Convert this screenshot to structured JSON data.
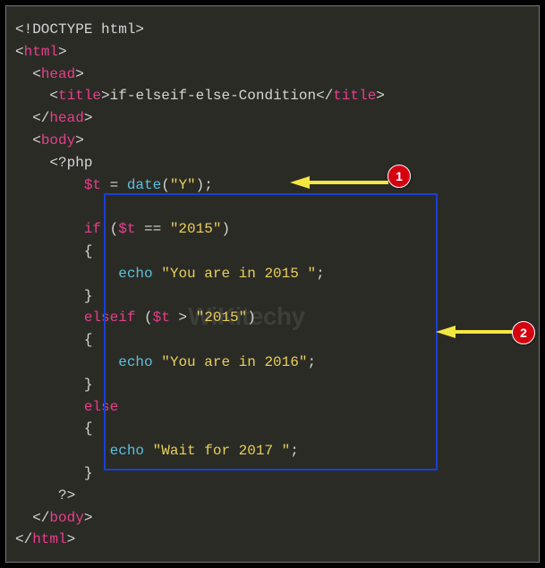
{
  "code": {
    "l1": "<!DOCTYPE html>",
    "l2_open": "<",
    "l2_tag": "html",
    "l2_close": ">",
    "l3_open": "  <",
    "l3_tag": "head",
    "l3_close": ">",
    "l4_open": "    <",
    "l4_tag": "title",
    "l4_close": ">",
    "l4_text": "if-elseif-else-Condition",
    "l4_endopen": "</",
    "l4_endtag": "title",
    "l4_endclose": ">",
    "l5_open": "  </",
    "l5_tag": "head",
    "l5_close": ">",
    "l6_open": "  <",
    "l6_tag": "body",
    "l6_close": ">",
    "l7": "    <?php",
    "l8_indent": "        ",
    "l8_var": "$t",
    "l8_op": " = ",
    "l8_func": "date",
    "l8_p1": "(",
    "l8_str": "\"Y\"",
    "l8_p2": ");",
    "l10_indent": "        ",
    "l10_kw": "if",
    "l10_p1": " (",
    "l10_var": "$t",
    "l10_op": " == ",
    "l10_str": "\"2015\"",
    "l10_p2": ")",
    "l11": "        {",
    "l12_indent": "            ",
    "l12_echo": "echo",
    "l12_sp": " ",
    "l12_str": "\"You are in 2015 \"",
    "l12_semi": ";",
    "l13": "        }",
    "l14_indent": "        ",
    "l14_kw": "elseif",
    "l14_p1": " (",
    "l14_var": "$t",
    "l14_op": " > ",
    "l14_str": "\"2015\"",
    "l14_p2": ")",
    "l15": "        {",
    "l16_indent": "            ",
    "l16_echo": "echo",
    "l16_sp": " ",
    "l16_str": "\"You are in 2016\"",
    "l16_semi": ";",
    "l17": "        }",
    "l18_indent": "        ",
    "l18_kw": "else",
    "l19": "        {",
    "l20_indent": "           ",
    "l20_echo": "echo",
    "l20_sp": " ",
    "l20_str": "\"Wait for 2017 \"",
    "l20_semi": ";",
    "l21": "        }",
    "l22": "     ?>",
    "l23_open": "  </",
    "l23_tag": "body",
    "l23_close": ">",
    "l24_open": "</",
    "l24_tag": "html",
    "l24_close": ">"
  },
  "annotations": {
    "badge1": "1",
    "badge2": "2"
  },
  "watermark": "WiKitechy"
}
